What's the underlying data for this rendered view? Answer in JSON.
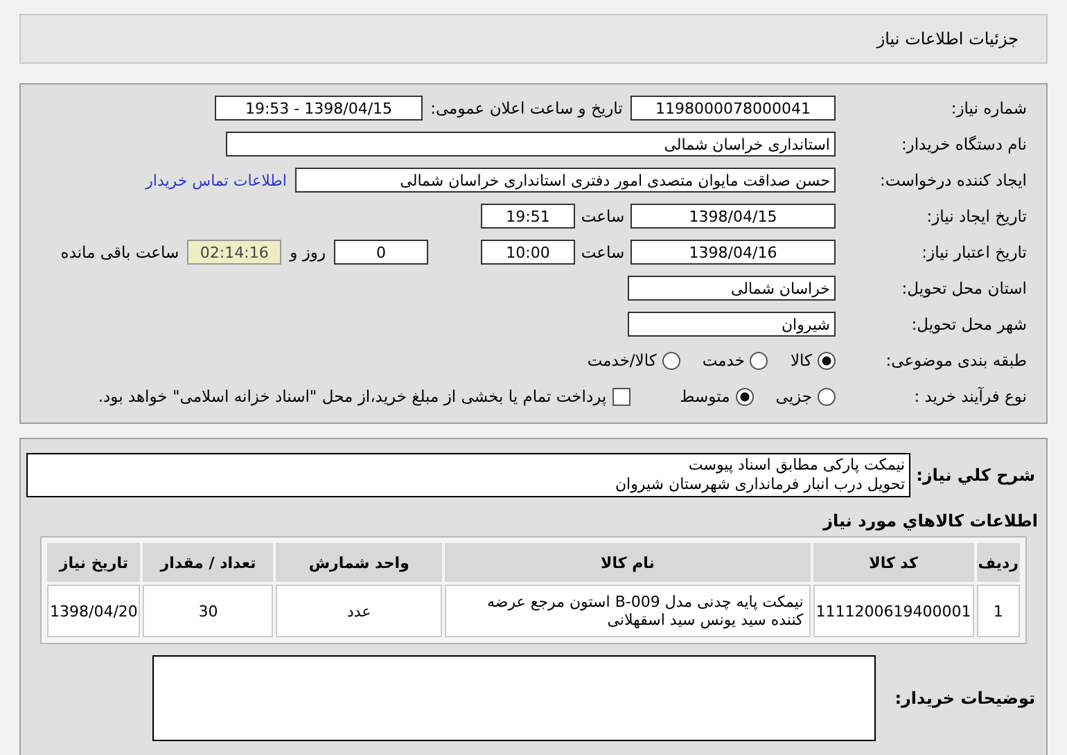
{
  "header": {
    "title": "جزئیات اطلاعات نیاز"
  },
  "need_number": {
    "label": "شماره نیاز:",
    "value": "1198000078000041"
  },
  "announce": {
    "label": "تاریخ و ساعت اعلان عمومی:",
    "value": "1398/04/15 - 19:53"
  },
  "buyer_org": {
    "label": "نام دستگاه خریدار:",
    "value": "استانداری خراسان شمالی"
  },
  "requester": {
    "label": "ایجاد کننده درخواست:",
    "value": "حسن صداقت مایوان متصدی امور دفتری استانداری خراسان شمالی",
    "link": "اطلاعات تماس خریدار"
  },
  "created": {
    "label": "تاریخ ایجاد نیاز:",
    "date": "1398/04/15",
    "time_label": "ساعت",
    "time": "19:51"
  },
  "validity": {
    "label": "تاریخ اعتبار نیاز:",
    "date": "1398/04/16",
    "time_label": "ساعت",
    "time": "10:00",
    "days": "0",
    "days_label": "روز و",
    "remaining": "02:14:16",
    "remaining_label": "ساعت باقی مانده"
  },
  "province": {
    "label": "استان محل تحویل:",
    "value": "خراسان شمالی"
  },
  "city": {
    "label": "شهر محل تحویل:",
    "value": "شیروان"
  },
  "category": {
    "label": "طبقه بندی موضوعی:",
    "options": [
      {
        "label": "کالا",
        "selected": true
      },
      {
        "label": "خدمت",
        "selected": false
      },
      {
        "label": "کالا/خدمت",
        "selected": false
      }
    ]
  },
  "process": {
    "label": "نوع فرآیند خرید :",
    "options": [
      {
        "label": "جزیی",
        "selected": false
      },
      {
        "label": "متوسط",
        "selected": true
      }
    ],
    "payment": {
      "label": "پرداخت تمام یا بخشی از مبلغ خرید،از محل \"اسناد خزانه اسلامی\" خواهد بود.",
      "checked": false
    }
  },
  "description": {
    "label": "شرح کلي نياز:",
    "lines": [
      "نیمکت پارکی مطابق اسناد پیوست",
      "تحویل درب انبار فرمانداری شهرستان شیروان"
    ]
  },
  "goods": {
    "title": "اطلاعات کالاهاي مورد نياز",
    "columns": [
      "ردیف",
      "کد کالا",
      "نام کالا",
      "واحد شمارش",
      "تعداد / مقدار",
      "تاریخ نیاز"
    ],
    "rows": [
      [
        "1",
        "1111200619400001",
        "نیمکت پایه چدنی مدل B-009 استون مرجع عرضه کننده سید یونس سید اسقهلانی",
        "عدد",
        "30",
        "1398/04/20"
      ]
    ]
  },
  "buyer_notes": {
    "label": "توضیحات خریدار:"
  }
}
